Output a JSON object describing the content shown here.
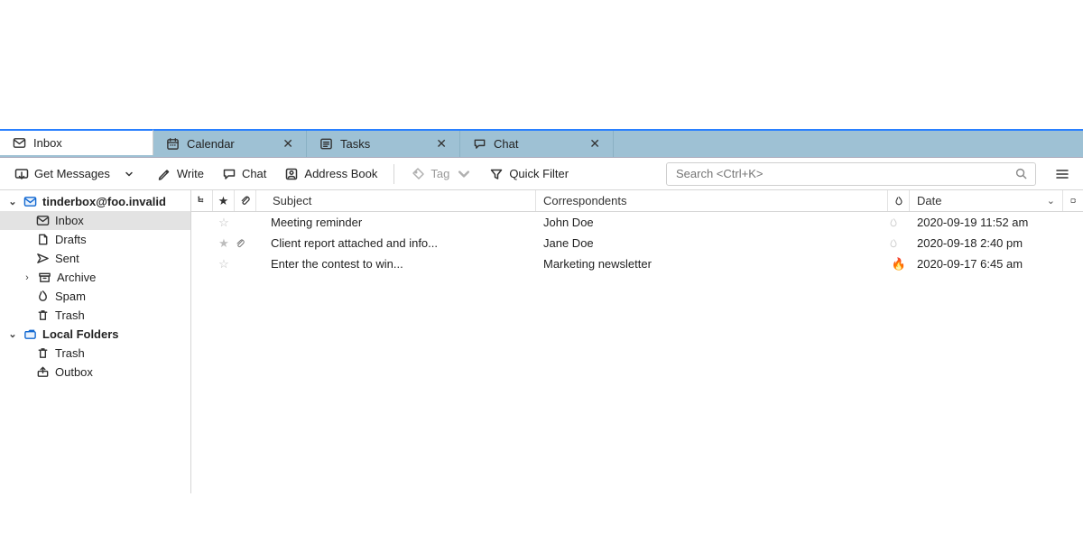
{
  "tabs": [
    {
      "label": "Inbox",
      "icon": "mail-icon",
      "closable": false,
      "active": true
    },
    {
      "label": "Calendar",
      "icon": "calendar-icon",
      "closable": true,
      "active": false
    },
    {
      "label": "Tasks",
      "icon": "tasks-icon",
      "closable": true,
      "active": false
    },
    {
      "label": "Chat",
      "icon": "chat-icon",
      "closable": true,
      "active": false
    }
  ],
  "toolbar": {
    "get_messages": "Get Messages",
    "write": "Write",
    "chat": "Chat",
    "address_book": "Address Book",
    "tag": "Tag",
    "quick_filter": "Quick Filter"
  },
  "search": {
    "placeholder": "Search <Ctrl+K>"
  },
  "sidebar": {
    "accounts": [
      {
        "name": "tinderbox@foo.invalid",
        "expanded": true,
        "folders": [
          {
            "label": "Inbox",
            "icon": "mail-icon",
            "selected": true
          },
          {
            "label": "Drafts",
            "icon": "draft-icon"
          },
          {
            "label": "Sent",
            "icon": "sent-icon"
          },
          {
            "label": "Archive",
            "icon": "archive-icon",
            "has_children": true
          },
          {
            "label": "Spam",
            "icon": "spam-icon"
          },
          {
            "label": "Trash",
            "icon": "trash-icon"
          }
        ]
      },
      {
        "name": "Local Folders",
        "expanded": true,
        "folders": [
          {
            "label": "Trash",
            "icon": "trash-icon"
          },
          {
            "label": "Outbox",
            "icon": "outbox-icon"
          }
        ]
      }
    ]
  },
  "columns": {
    "thread": "",
    "star": "",
    "attachment": "",
    "subject": "Subject",
    "correspondents": "Correspondents",
    "hot": "",
    "date": "Date"
  },
  "messages": [
    {
      "starred": false,
      "attachment": false,
      "subject": "Meeting reminder",
      "from": "John Doe",
      "hot": "low",
      "date": "2020-09-19 11:52 am"
    },
    {
      "starred": true,
      "attachment": true,
      "subject": "Client report attached and info...",
      "from": "Jane Doe",
      "hot": "low",
      "date": "2020-09-18 2:40 pm"
    },
    {
      "starred": false,
      "attachment": false,
      "subject": "Enter the contest to win...",
      "from": "Marketing newsletter",
      "hot": "high",
      "date": "2020-09-17 6:45 am"
    }
  ]
}
